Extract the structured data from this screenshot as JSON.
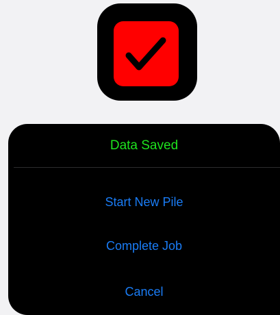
{
  "status_icon": {
    "name": "checkmark-icon",
    "background_color": "#ff0000",
    "mark_color": "#000000"
  },
  "sheet": {
    "title": "Data Saved",
    "title_color": "#1ee31e",
    "actions": [
      {
        "label": "Start New Pile"
      },
      {
        "label": "Complete Job"
      },
      {
        "label": "Cancel"
      }
    ],
    "action_color": "#1a7cf5"
  }
}
